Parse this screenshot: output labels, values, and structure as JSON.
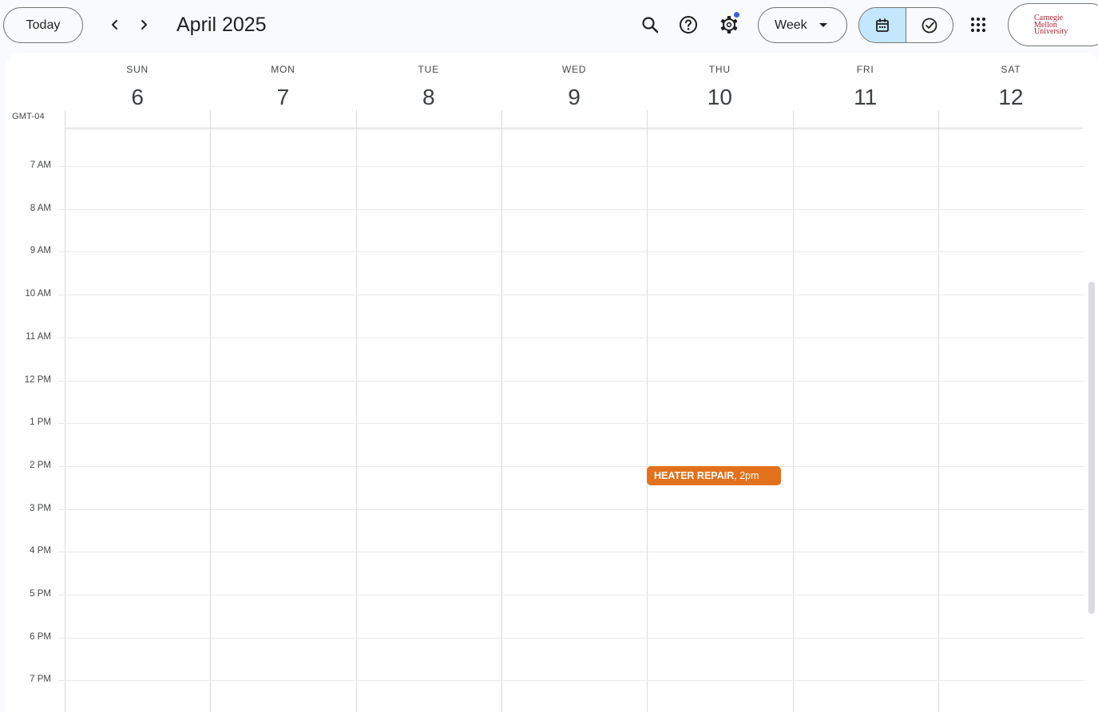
{
  "toolbar": {
    "today_label": "Today",
    "month_title": "April 2025",
    "view_label": "Week",
    "account_logo_lines": [
      "Carnegie",
      "Mellon",
      "University"
    ]
  },
  "calendar": {
    "timezone": "GMT-04",
    "days": [
      {
        "name": "SUN",
        "num": "6"
      },
      {
        "name": "MON",
        "num": "7"
      },
      {
        "name": "TUE",
        "num": "8"
      },
      {
        "name": "WED",
        "num": "9"
      },
      {
        "name": "THU",
        "num": "10"
      },
      {
        "name": "FRI",
        "num": "11"
      },
      {
        "name": "SAT",
        "num": "12"
      }
    ],
    "hours": [
      "7 AM",
      "8 AM",
      "9 AM",
      "10 AM",
      "11 AM",
      "12 PM",
      "1 PM",
      "2 PM",
      "3 PM",
      "4 PM",
      "5 PM",
      "6 PM",
      "7 PM"
    ],
    "events": [
      {
        "title": "HEATER REPAIR",
        "time": ", 2pm",
        "color": "#e3711c",
        "day": "THU"
      }
    ]
  },
  "colors": {
    "accent": "#c2e7ff",
    "notification_dot": "#3a63d8",
    "event": "#e3711c",
    "logo": "#b02032"
  }
}
